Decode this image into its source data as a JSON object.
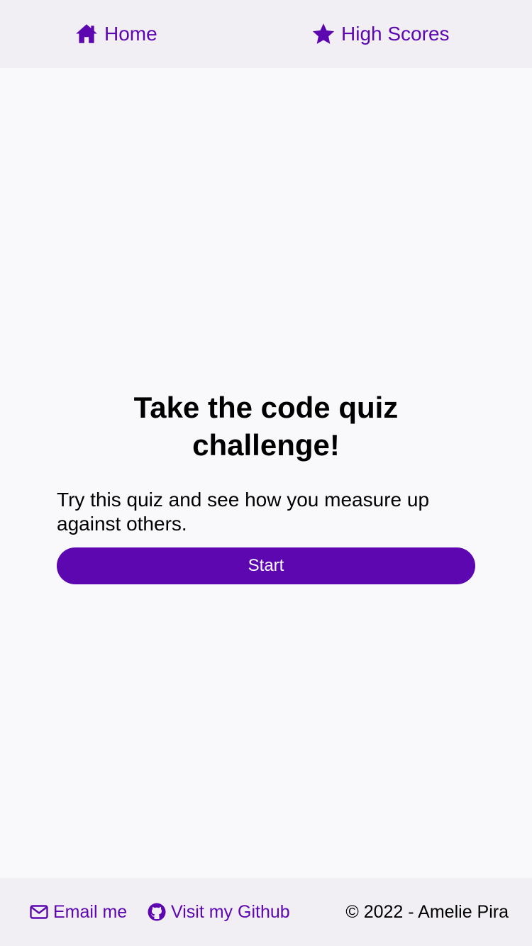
{
  "colors": {
    "accent": "#5c07b0",
    "nav_background": "#f1eff4",
    "page_background": "#f9f9fb",
    "button_text": "#ffffff"
  },
  "nav": {
    "home": {
      "label": "Home",
      "icon": "home-icon"
    },
    "high_scores": {
      "label": "High Scores",
      "icon": "star-icon"
    }
  },
  "main": {
    "title": "Take the code quiz challenge!",
    "lead": "Try this quiz and see how you measure up against others.",
    "start_label": "Start"
  },
  "footer": {
    "email": {
      "label": "Email me",
      "icon": "envelope-icon"
    },
    "github": {
      "label": "Visit my Github",
      "icon": "github-icon"
    },
    "copyright": "© 2022 - Amelie Pira"
  }
}
